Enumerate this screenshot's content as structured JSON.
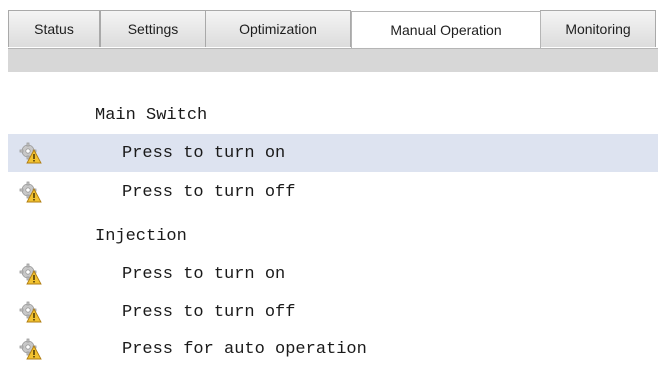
{
  "tabs": [
    {
      "label": "Status"
    },
    {
      "label": "Settings"
    },
    {
      "label": "Optimization"
    },
    {
      "label": "Manual Operation"
    },
    {
      "label": "Monitoring"
    }
  ],
  "active_tab": "Manual Operation",
  "sections": [
    {
      "title": "Main Switch",
      "items": [
        {
          "label": "Press to turn on",
          "icon": "gear-warning-icon"
        },
        {
          "label": "Press to turn off",
          "icon": "gear-warning-icon"
        }
      ]
    },
    {
      "title": "Injection",
      "items": [
        {
          "label": "Press to turn on",
          "icon": "gear-warning-icon"
        },
        {
          "label": "Press to turn off",
          "icon": "gear-warning-icon"
        },
        {
          "label": "Press for auto operation",
          "icon": "gear-warning-icon"
        }
      ]
    }
  ],
  "colors": {
    "selected_row": "#dde3f0",
    "band": "#d7d7d7",
    "warning": "#f2c230"
  }
}
